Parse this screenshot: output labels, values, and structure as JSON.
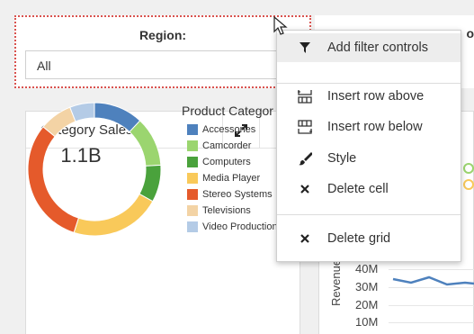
{
  "filters": {
    "region_label": "Region:",
    "region_value": "All",
    "second_label_fragment": "o"
  },
  "panel": {
    "title": "Category Sales",
    "center_value": "1.1B",
    "legend_title": "Product Categor",
    "legend": [
      {
        "label": "Accessories",
        "color": "#4e81bd"
      },
      {
        "label": "Camcorder",
        "color": "#9bd56f"
      },
      {
        "label": "Computers",
        "color": "#4aa23c"
      },
      {
        "label": "Media Player",
        "color": "#f9c95a"
      },
      {
        "label": "Stereo Systems",
        "color": "#e55a2b"
      },
      {
        "label": "Televisions",
        "color": "#f3d3a5"
      },
      {
        "label": "Video Production",
        "color": "#b4cbe6"
      }
    ]
  },
  "chart2": {
    "axis_title": "Revenue",
    "ticks": [
      "40M",
      "30M",
      "20M",
      "10M"
    ]
  },
  "menu": {
    "items": [
      {
        "label": "Add filter controls",
        "icon": "filter-icon"
      },
      {
        "label": "Insert row above",
        "icon": "insert-row-above-icon"
      },
      {
        "label": "Insert row below",
        "icon": "insert-row-below-icon"
      },
      {
        "label": "Style",
        "icon": "brush-icon"
      },
      {
        "label": "Delete cell",
        "icon": "delete-icon"
      },
      {
        "label": "Delete grid",
        "icon": "delete-icon"
      }
    ]
  }
}
